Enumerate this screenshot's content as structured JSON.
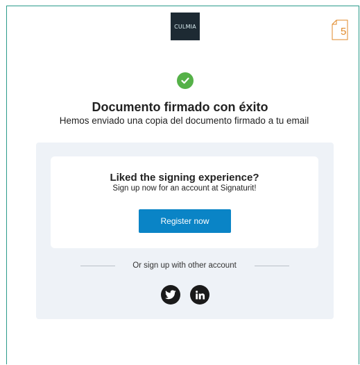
{
  "header": {
    "logo_text": "CULMIA",
    "page_number": "5"
  },
  "success": {
    "title": "Documento firmado con éxito",
    "subtitle": "Hemos enviado una copia del documento firmado a tu email"
  },
  "signup_card": {
    "heading": "Liked the signing experience?",
    "subheading": "Sign up now for an account at Signaturit!",
    "register_label": "Register now"
  },
  "social": {
    "divider_label": "Or sign up with other account",
    "providers": [
      "twitter-icon",
      "linkedin-icon"
    ]
  },
  "colors": {
    "accent_button": "#0a84c6",
    "success_check": "#55b148",
    "page_badge": "#e08a2a",
    "panel_bg": "#eef2f7"
  }
}
